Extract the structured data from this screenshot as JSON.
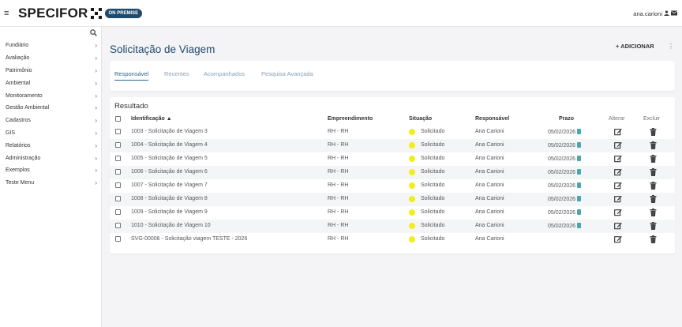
{
  "topbar": {
    "brand": "SPECIFOR",
    "badge": "ON PREMISE",
    "user": "ana.carioni"
  },
  "sidebar": {
    "items": [
      {
        "label": "Fundiário"
      },
      {
        "label": "Avaliação"
      },
      {
        "label": "Patrimônio"
      },
      {
        "label": "Ambiental"
      },
      {
        "label": "Monitoramento"
      },
      {
        "label": "Gestão Ambiental"
      },
      {
        "label": "Cadastros"
      },
      {
        "label": "GIS"
      },
      {
        "label": "Relatórios"
      },
      {
        "label": "Administração"
      },
      {
        "label": "Exemplos"
      },
      {
        "label": "Teste Menu"
      }
    ]
  },
  "page": {
    "title": "Solicitação de Viagem",
    "add_label": "+ ADICIONAR",
    "kebab": "⋮"
  },
  "tabs": [
    {
      "label": "Responsável",
      "active": true
    },
    {
      "label": "Recentes",
      "active": false
    },
    {
      "label": "Acompanhados",
      "active": false
    },
    {
      "label": "Pesquisa Avançada",
      "active": false
    }
  ],
  "table": {
    "title": "Resultado",
    "headers": {
      "identificacao": "Identificação ▲",
      "empreendimento": "Empreendimento",
      "situacao": "Situação",
      "responsavel": "Responsável",
      "prazo": "Prazo",
      "alterar": "Alterar",
      "excluir": "Excluir"
    },
    "rows": [
      {
        "id": "1003 - Solicitação de Viagem 3",
        "emp": "RH - RH",
        "sit": "Solicitado",
        "resp": "Ana Carioni",
        "prazo": "05/02/2026"
      },
      {
        "id": "1004 - Solicitação de Viagem 4",
        "emp": "RH - RH",
        "sit": "Solicitado",
        "resp": "Ana Carioni",
        "prazo": "05/02/2026"
      },
      {
        "id": "1005 - Solicitação de Viagem 5",
        "emp": "RH - RH",
        "sit": "Solicitado",
        "resp": "Ana Carioni",
        "prazo": "05/02/2026"
      },
      {
        "id": "1006 - Solicitação de Viagem 6",
        "emp": "RH - RH",
        "sit": "Solicitado",
        "resp": "Ana Carioni",
        "prazo": "05/02/2026"
      },
      {
        "id": "1007 - Solicitação de Viagem 7",
        "emp": "RH - RH",
        "sit": "Solicitado",
        "resp": "Ana Carioni",
        "prazo": "05/02/2026"
      },
      {
        "id": "1008 - Solicitação de Viagem 8",
        "emp": "RH - RH",
        "sit": "Solicitado",
        "resp": "Ana Carioni",
        "prazo": "05/02/2026"
      },
      {
        "id": "1009 - Solicitação de Viagem 9",
        "emp": "RH - RH",
        "sit": "Solicitado",
        "resp": "Ana Carioni",
        "prazo": "05/02/2026"
      },
      {
        "id": "1010 - Solicitação de Viagem 10",
        "emp": "RH - RH",
        "sit": "Solicitado",
        "resp": "Ana Carioni",
        "prazo": "05/02/2026"
      },
      {
        "id": "SVG-00006 - Solicitação viagem TESTE - 2026",
        "emp": "RH - RH",
        "sit": "Solicitado",
        "resp": "Ana Carioni",
        "prazo": ""
      }
    ]
  },
  "colors": {
    "brand_navy": "#1e4a6e",
    "status_yellow": "#f1ee1e",
    "clock_teal": "#4aa6b5"
  },
  "icons": [
    "menu-icon",
    "search-icon",
    "user-icon",
    "mail-icon",
    "edit-icon",
    "trash-icon",
    "clock-icon",
    "chevron-right-icon"
  ]
}
